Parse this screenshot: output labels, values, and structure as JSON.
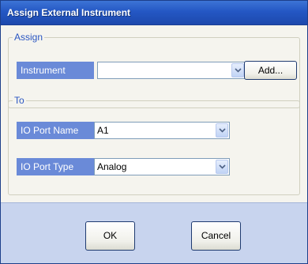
{
  "window": {
    "title": "Assign External Instrument"
  },
  "assign_group": {
    "legend": "Assign",
    "instrument_label": "Instrument",
    "instrument_value": "",
    "add_button": "Add..."
  },
  "to_group": {
    "legend": "To",
    "port_name_label": "IO Port Name",
    "port_name_value": "A1",
    "port_type_label": "IO Port Type",
    "port_type_value": "Analog"
  },
  "footer": {
    "ok_button": "OK",
    "cancel_button": "Cancel"
  },
  "colors": {
    "title_bar": "#2457c4",
    "label_background": "#6a8ad8",
    "legend_text": "#2a56c2",
    "footer_background": "#c8d4ee"
  },
  "icons": [
    "chevron-down-icon"
  ]
}
